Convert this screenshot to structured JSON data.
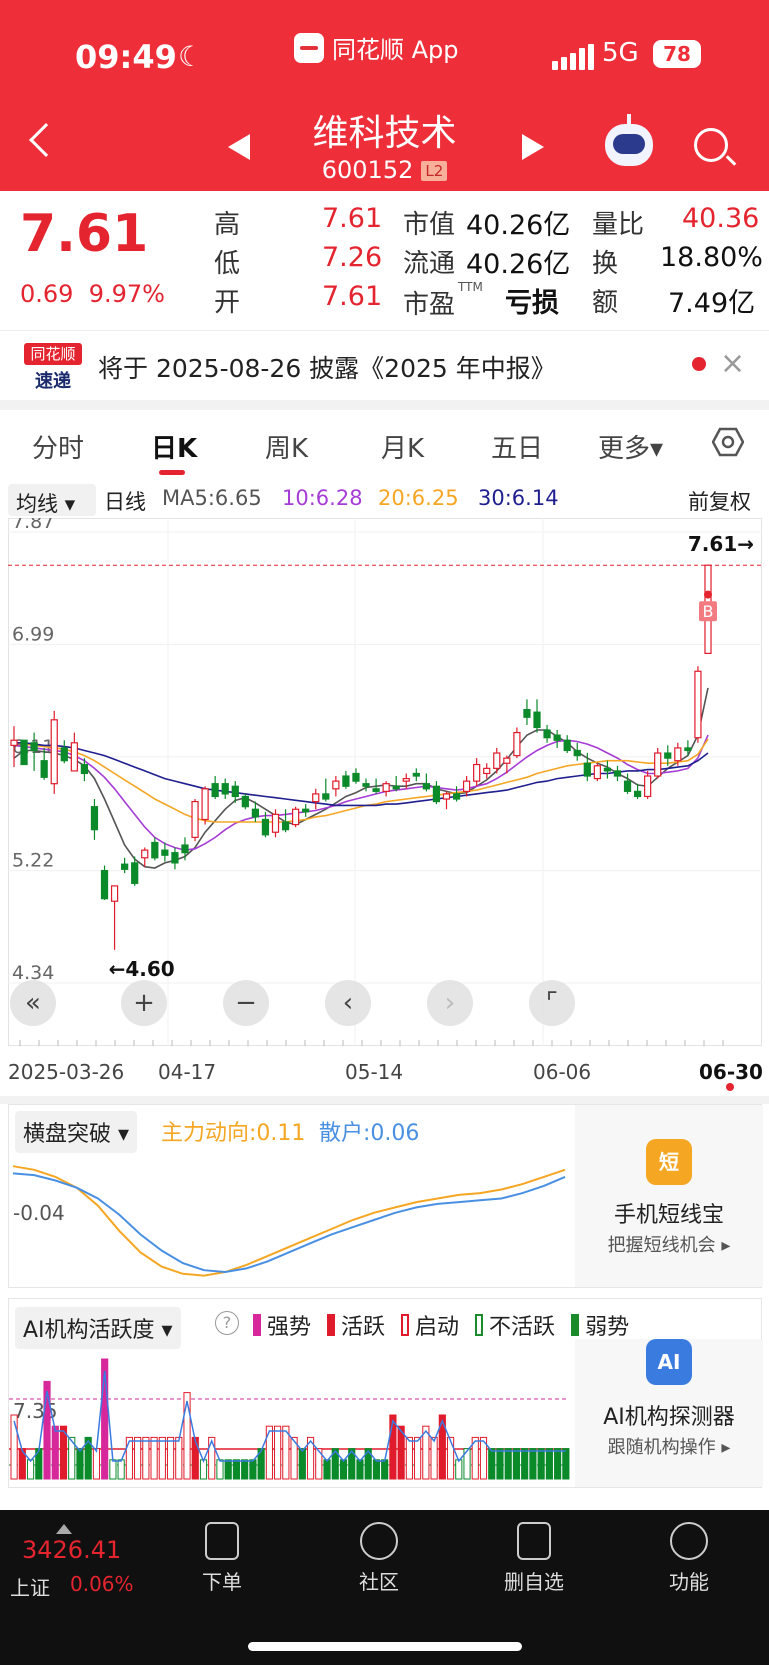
{
  "status_bar": {
    "time": "09:49",
    "network": "5G",
    "battery": "78"
  },
  "app_link": {
    "label": "同花顺 App"
  },
  "stock": {
    "name": "维科技术",
    "code": "600152",
    "level_badge": "L2"
  },
  "quote": {
    "price": "7.61",
    "change": "0.69",
    "change_pct": "9.97%",
    "high_label": "高",
    "high": "7.61",
    "low_label": "低",
    "low": "7.26",
    "open_label": "开",
    "open": "7.61",
    "mktcap_label": "市值",
    "mktcap": "40.26亿",
    "float_label": "流通",
    "float": "40.26亿",
    "pe_label": "市盈",
    "pe_sup": "TTM",
    "pe": "亏损",
    "volratio_label": "量比",
    "volratio": "40.36",
    "turnover_label": "换",
    "turnover": "18.80%",
    "amount_label": "额",
    "amount": "7.49亿"
  },
  "notice": {
    "logo_top": "同花顺",
    "logo_bottom": "速递",
    "text": "将于 2025-08-26 披露《2025 年中报》",
    "close": "×"
  },
  "tabs": [
    "分时",
    "日K",
    "周K",
    "月K",
    "五日",
    "更多▾"
  ],
  "active_tab": "日K",
  "ma_bar": {
    "type_label": "均线",
    "period": "日线",
    "ma5": "MA5:6.65",
    "ma10": "10:6.28",
    "ma20": "20:6.25",
    "ma30": "30:6.14",
    "adjust": "前复权"
  },
  "chart_data": {
    "type": "candlestick",
    "price_ticks": [
      "7.87",
      "6.99",
      "6.11",
      "5.22",
      "4.34"
    ],
    "ylim": [
      4.34,
      7.87
    ],
    "x_dates": [
      "2025-03-26",
      "04-17",
      "05-14",
      "06-06",
      "06-30"
    ],
    "last_price_tag": "7.61→",
    "low_tag": "←4.60",
    "buy_marker": "B",
    "candles": [
      [
        6.2,
        6.35,
        6.03,
        6.24
      ],
      [
        6.24,
        6.22,
        6.08,
        6.05
      ],
      [
        6.22,
        6.3,
        6.0,
        6.16
      ],
      [
        6.08,
        6.18,
        5.93,
        5.95
      ],
      [
        5.9,
        6.47,
        5.82,
        6.4
      ],
      [
        6.18,
        6.24,
        6.06,
        6.08
      ],
      [
        6.0,
        6.3,
        6.0,
        6.22
      ],
      [
        6.05,
        6.1,
        5.92,
        5.98
      ],
      [
        5.72,
        5.78,
        5.46,
        5.54
      ],
      [
        5.22,
        5.26,
        4.99,
        5.0
      ],
      [
        4.98,
        5.08,
        4.6,
        5.1
      ],
      [
        5.27,
        5.32,
        5.2,
        5.23
      ],
      [
        5.28,
        5.33,
        5.1,
        5.12
      ],
      [
        5.32,
        5.4,
        5.25,
        5.38
      ],
      [
        5.44,
        5.48,
        5.3,
        5.32
      ],
      [
        5.38,
        5.44,
        5.29,
        5.34
      ],
      [
        5.36,
        5.4,
        5.23,
        5.28
      ],
      [
        5.42,
        5.48,
        5.3,
        5.36
      ],
      [
        5.48,
        5.78,
        5.45,
        5.76
      ],
      [
        5.62,
        5.88,
        5.58,
        5.86
      ],
      [
        5.9,
        5.96,
        5.78,
        5.8
      ],
      [
        5.9,
        5.94,
        5.78,
        5.82
      ],
      [
        5.88,
        5.92,
        5.75,
        5.8
      ],
      [
        5.8,
        5.82,
        5.7,
        5.72
      ],
      [
        5.7,
        5.76,
        5.6,
        5.64
      ],
      [
        5.62,
        5.68,
        5.48,
        5.5
      ],
      [
        5.52,
        5.7,
        5.48,
        5.66
      ],
      [
        5.6,
        5.7,
        5.52,
        5.54
      ],
      [
        5.58,
        5.72,
        5.56,
        5.7
      ],
      [
        5.7,
        5.74,
        5.64,
        5.68
      ],
      [
        5.76,
        5.86,
        5.7,
        5.82
      ],
      [
        5.82,
        5.94,
        5.76,
        5.78
      ],
      [
        5.86,
        5.96,
        5.8,
        5.92
      ],
      [
        5.96,
        6.0,
        5.86,
        5.88
      ],
      [
        5.98,
        6.02,
        5.9,
        5.92
      ],
      [
        5.9,
        5.94,
        5.84,
        5.88
      ],
      [
        5.86,
        5.94,
        5.82,
        5.84
      ],
      [
        5.84,
        5.92,
        5.8,
        5.9
      ],
      [
        5.88,
        5.96,
        5.84,
        5.86
      ],
      [
        5.92,
        5.98,
        5.86,
        5.94
      ],
      [
        5.98,
        6.02,
        5.92,
        5.96
      ],
      [
        5.9,
        5.98,
        5.84,
        5.86
      ],
      [
        5.88,
        5.92,
        5.74,
        5.76
      ],
      [
        5.78,
        5.84,
        5.7,
        5.82
      ],
      [
        5.82,
        5.88,
        5.76,
        5.78
      ],
      [
        5.84,
        5.96,
        5.8,
        5.92
      ],
      [
        5.92,
        6.1,
        5.88,
        6.05
      ],
      [
        5.98,
        6.06,
        5.94,
        6.02
      ],
      [
        6.02,
        6.18,
        5.98,
        6.14
      ],
      [
        6.06,
        6.12,
        5.98,
        6.1
      ],
      [
        6.12,
        6.34,
        6.1,
        6.3
      ],
      [
        6.48,
        6.56,
        6.36,
        6.42
      ],
      [
        6.46,
        6.56,
        6.3,
        6.34
      ],
      [
        6.32,
        6.36,
        6.22,
        6.26
      ],
      [
        6.28,
        6.32,
        6.18,
        6.24
      ],
      [
        6.24,
        6.28,
        6.14,
        6.16
      ],
      [
        6.16,
        6.22,
        6.08,
        6.12
      ],
      [
        6.06,
        6.14,
        5.92,
        5.96
      ],
      [
        5.94,
        6.06,
        5.92,
        6.04
      ],
      [
        6.02,
        6.08,
        5.94,
        6.0
      ],
      [
        6.0,
        6.04,
        5.92,
        5.96
      ],
      [
        5.92,
        5.98,
        5.82,
        5.84
      ],
      [
        5.84,
        5.9,
        5.78,
        5.8
      ],
      [
        5.8,
        6.0,
        5.78,
        5.96
      ],
      [
        5.96,
        6.18,
        5.94,
        6.14
      ],
      [
        6.14,
        6.2,
        6.04,
        6.1
      ],
      [
        6.08,
        6.22,
        6.04,
        6.18
      ],
      [
        6.18,
        6.24,
        6.12,
        6.16
      ],
      [
        6.26,
        6.82,
        6.22,
        6.78
      ],
      [
        6.92,
        7.61,
        6.92,
        7.61
      ]
    ],
    "ma_series": [
      {
        "name": "MA5",
        "color": "#555555",
        "values": [
          6.1,
          6.16,
          6.16,
          6.15,
          6.14,
          6.12,
          6.09,
          6.04,
          5.94,
          5.78,
          5.6,
          5.42,
          5.31,
          5.25,
          5.24,
          5.28,
          5.3,
          5.33,
          5.4,
          5.52,
          5.61,
          5.7,
          5.77,
          5.79,
          5.75,
          5.7,
          5.65,
          5.6,
          5.58,
          5.62,
          5.66,
          5.7,
          5.75,
          5.8,
          5.83,
          5.87,
          5.88,
          5.89,
          5.88,
          5.88,
          5.9,
          5.9,
          5.86,
          5.84,
          5.82,
          5.83,
          5.88,
          5.93,
          6.0,
          6.09,
          6.19,
          6.28,
          6.32,
          6.32,
          6.27,
          6.22,
          6.15,
          6.1,
          6.06,
          6.03,
          5.98,
          5.94,
          5.89,
          5.88,
          5.95,
          6.02,
          6.07,
          6.12,
          6.28,
          6.65
        ]
      },
      {
        "name": "MA10",
        "color": "#a63cd6",
        "values": [
          6.2,
          6.19,
          6.18,
          6.17,
          6.16,
          6.15,
          6.12,
          6.08,
          6.02,
          5.95,
          5.86,
          5.76,
          5.66,
          5.56,
          5.48,
          5.43,
          5.4,
          5.38,
          5.39,
          5.43,
          5.48,
          5.54,
          5.59,
          5.62,
          5.64,
          5.65,
          5.65,
          5.66,
          5.67,
          5.68,
          5.69,
          5.71,
          5.73,
          5.76,
          5.78,
          5.8,
          5.82,
          5.84,
          5.85,
          5.86,
          5.87,
          5.88,
          5.87,
          5.86,
          5.85,
          5.86,
          5.88,
          5.9,
          5.94,
          5.99,
          6.05,
          6.11,
          6.16,
          6.2,
          6.23,
          6.24,
          6.23,
          6.21,
          6.18,
          6.14,
          6.1,
          6.05,
          6.01,
          5.98,
          5.98,
          5.99,
          6.0,
          6.02,
          6.1,
          6.28
        ]
      },
      {
        "name": "MA20",
        "color": "#f5a623",
        "values": [
          6.22,
          6.21,
          6.2,
          6.19,
          6.18,
          6.17,
          6.15,
          6.12,
          6.08,
          6.03,
          5.98,
          5.93,
          5.88,
          5.83,
          5.78,
          5.74,
          5.7,
          5.66,
          5.63,
          5.61,
          5.6,
          5.6,
          5.6,
          5.6,
          5.6,
          5.6,
          5.6,
          5.6,
          5.61,
          5.62,
          5.64,
          5.65,
          5.67,
          5.69,
          5.71,
          5.73,
          5.74,
          5.76,
          5.77,
          5.78,
          5.79,
          5.8,
          5.81,
          5.82,
          5.83,
          5.84,
          5.85,
          5.87,
          5.89,
          5.91,
          5.93,
          5.95,
          5.98,
          6.0,
          6.02,
          6.04,
          6.05,
          6.06,
          6.07,
          6.08,
          6.08,
          6.08,
          6.07,
          6.06,
          6.06,
          6.06,
          6.07,
          6.08,
          6.13,
          6.25
        ]
      },
      {
        "name": "MA30",
        "color": "#1f1f8f",
        "values": [
          6.22,
          6.22,
          6.21,
          6.2,
          6.2,
          6.19,
          6.18,
          6.16,
          6.14,
          6.12,
          6.09,
          6.06,
          6.03,
          6.0,
          5.97,
          5.94,
          5.92,
          5.9,
          5.88,
          5.86,
          5.85,
          5.84,
          5.83,
          5.82,
          5.81,
          5.8,
          5.79,
          5.78,
          5.77,
          5.76,
          5.75,
          5.74,
          5.73,
          5.73,
          5.73,
          5.73,
          5.73,
          5.74,
          5.74,
          5.75,
          5.76,
          5.77,
          5.78,
          5.79,
          5.8,
          5.81,
          5.82,
          5.83,
          5.84,
          5.85,
          5.87,
          5.89,
          5.91,
          5.92,
          5.94,
          5.95,
          5.96,
          5.97,
          5.98,
          5.98,
          5.99,
          6.0,
          6.0,
          6.01,
          6.01,
          6.02,
          6.03,
          6.04,
          6.08,
          6.14
        ]
      }
    ]
  },
  "chart_controls": [
    "«",
    "+",
    "−",
    "‹",
    "›",
    "⌜"
  ],
  "indicator": {
    "dropdown": "横盘突破 ▾",
    "main_force": "主力动向:0.11",
    "retail": "散户:0.06",
    "tick": "-0.04",
    "card_title": "手机短线宝",
    "card_sub": "把握短线机会 ▸",
    "card_icon": "短",
    "series": [
      {
        "name": "主力动向",
        "color": "#f5a623",
        "values": [
          0.3,
          0.28,
          0.24,
          0.18,
          0.08,
          -0.06,
          -0.18,
          -0.26,
          -0.3,
          -0.31,
          -0.29,
          -0.25,
          -0.2,
          -0.15,
          -0.1,
          -0.05,
          0.0,
          0.04,
          0.07,
          0.1,
          0.12,
          0.14,
          0.15,
          0.17,
          0.2,
          0.24,
          0.28
        ]
      },
      {
        "name": "散户",
        "color": "#4a90e2",
        "values": [
          0.26,
          0.25,
          0.22,
          0.18,
          0.12,
          0.03,
          -0.08,
          -0.17,
          -0.24,
          -0.28,
          -0.29,
          -0.27,
          -0.23,
          -0.18,
          -0.13,
          -0.08,
          -0.04,
          0.0,
          0.04,
          0.07,
          0.09,
          0.1,
          0.11,
          0.12,
          0.15,
          0.19,
          0.24
        ]
      }
    ]
  },
  "ai_panel": {
    "dropdown": "AI机构活跃度 ▾",
    "help": "?",
    "legend": [
      {
        "label": "强势",
        "color": "#d6289a",
        "hollow": false
      },
      {
        "label": "活跃",
        "color": "#e01b2b",
        "hollow": false
      },
      {
        "label": "启动",
        "color": "#e01b2b",
        "hollow": true
      },
      {
        "label": "不活跃",
        "color": "#1a8a2a",
        "hollow": true
      },
      {
        "label": "弱势",
        "color": "#1a8a2a",
        "hollow": false
      }
    ],
    "tick": "7.35",
    "card_title": "AI机构探测器",
    "card_sub": "跟随机构操作 ▸",
    "card_icon": "AI",
    "bars": [
      2,
      3,
      0,
      1,
      5,
      6,
      3,
      0,
      1,
      1,
      2,
      6,
      0,
      0,
      2,
      2,
      2,
      2,
      2,
      2,
      2,
      2,
      3,
      0,
      2,
      0,
      1,
      1,
      1,
      1,
      1,
      2,
      2,
      2,
      2,
      1,
      2,
      2,
      1,
      1,
      1,
      1,
      1,
      1,
      1,
      1,
      3,
      3,
      2,
      2,
      2,
      2,
      3,
      2,
      0,
      0,
      2,
      2,
      1,
      1,
      1,
      1,
      1,
      1,
      1,
      1,
      1,
      1
    ],
    "bar_values": [
      0.5,
      0.2,
      0.1,
      0.2,
      0.8,
      0.4,
      0.4,
      0.3,
      0.2,
      0.3,
      0.2,
      1.0,
      0.1,
      0.1,
      0.3,
      0.3,
      0.3,
      0.3,
      0.3,
      0.3,
      0.3,
      0.7,
      0.3,
      0.1,
      0.3,
      0.1,
      0.1,
      0.1,
      0.1,
      0.1,
      0.2,
      0.4,
      0.4,
      0.4,
      0.3,
      0.2,
      0.3,
      0.2,
      0.1,
      0.2,
      0.1,
      0.2,
      0.1,
      0.2,
      0.1,
      0.1,
      0.5,
      0.4,
      0.3,
      0.3,
      0.4,
      0.3,
      0.5,
      0.3,
      0.1,
      0.2,
      0.3,
      0.3,
      0.2,
      0.2,
      0.2,
      0.2,
      0.2,
      0.2,
      0.2,
      0.2,
      0.2,
      0.2
    ]
  },
  "bottom_nav": {
    "index_value": "3426.41",
    "index_name": "上证",
    "index_change": "0.06%",
    "items": [
      "下单",
      "社区",
      "删自选",
      "功能"
    ]
  }
}
